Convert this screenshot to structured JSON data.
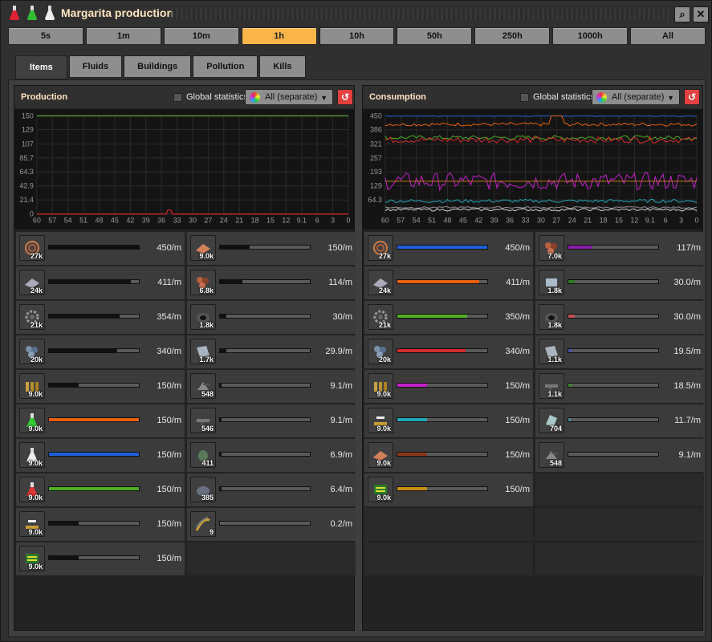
{
  "window": {
    "title": "Margarita production"
  },
  "title_icons": [
    "red-science-flask-icon",
    "green-science-flask-icon",
    "white-science-flask-icon"
  ],
  "time_buttons": [
    "5s",
    "1m",
    "10m",
    "1h",
    "10h",
    "50h",
    "250h",
    "1000h",
    "All"
  ],
  "active_time": "1h",
  "tabs": [
    "Items",
    "Fluids",
    "Buildings",
    "Pollution",
    "Kills"
  ],
  "active_tab": "Items",
  "production": {
    "title": "Production",
    "global_label": "Global statistics",
    "dropdown": "All (separate)",
    "chart_data": {
      "type": "line",
      "ylim": [
        0,
        150
      ],
      "yticks": [
        "150",
        "129",
        "107",
        "85.7",
        "64.3",
        "42.9",
        "21.4",
        "0"
      ],
      "xticks": [
        "60",
        "57",
        "54",
        "51",
        "48",
        "45",
        "42",
        "39",
        "36",
        "33",
        "30",
        "27",
        "24",
        "21",
        "18",
        "15",
        "12",
        "9.1",
        "6",
        "3",
        "0"
      ],
      "series": [
        {
          "color": "#6bb03a",
          "values": [
            150,
            150,
            150,
            150,
            150,
            150,
            150,
            150,
            150,
            150,
            150,
            150,
            150,
            150,
            150,
            150,
            150,
            150,
            150,
            150,
            150
          ]
        },
        {
          "color": "#d62b2b",
          "values": [
            0,
            0,
            0,
            0,
            0,
            0,
            0,
            0,
            0,
            0,
            0,
            0,
            0,
            0,
            0,
            0,
            0,
            0,
            0,
            0,
            0
          ],
          "spike_x": 34.5,
          "spike_y": 6
        }
      ]
    },
    "items": [
      {
        "icon": "copper-cable-icon",
        "count": "27k",
        "rate": "450/m",
        "fill": 1.0,
        "color": "#111111"
      },
      {
        "icon": "iron-plate-icon",
        "count": "24k",
        "rate": "411/m",
        "fill": 0.91,
        "color": "#111111"
      },
      {
        "icon": "iron-gear-wheel-icon",
        "count": "21k",
        "rate": "354/m",
        "fill": 0.79,
        "color": "#111111"
      },
      {
        "icon": "iron-ore-icon",
        "count": "20k",
        "rate": "340/m",
        "fill": 0.76,
        "color": "#111111"
      },
      {
        "icon": "firearm-magazine-icon",
        "count": "9.0k",
        "rate": "150/m",
        "fill": 0.33,
        "color": "#111111"
      },
      {
        "icon": "logistic-science-pack-icon",
        "count": "9.0k",
        "rate": "150/m",
        "fill": 1.0,
        "color": "#e8600c"
      },
      {
        "icon": "automation-science-pack-icon",
        "count": "9.0k",
        "rate": "150/m",
        "fill": 1.0,
        "color": "#1e5fd8"
      },
      {
        "icon": "military-science-pack-icon",
        "count": "9.0k",
        "rate": "150/m",
        "fill": 1.0,
        "color": "#4fae24"
      },
      {
        "icon": "inserter-icon",
        "count": "9.0k",
        "rate": "150/m",
        "fill": 0.33,
        "color": "#111111"
      },
      {
        "icon": "electronic-circuit-icon",
        "count": "9.0k",
        "rate": "150/m",
        "fill": 0.33,
        "color": "#111111"
      },
      {
        "icon": "copper-plate-icon",
        "count": "9.0k",
        "rate": "150/m",
        "fill": 0.33,
        "color": "#111111"
      },
      {
        "icon": "copper-ore-icon",
        "count": "6.8k",
        "rate": "114/m",
        "fill": 0.25,
        "color": "#111111"
      },
      {
        "icon": "stone-furnace-icon",
        "count": "1.8k",
        "rate": "30/m",
        "fill": 0.07,
        "color": "#111111"
      },
      {
        "icon": "steel-plate-icon",
        "count": "1.7k",
        "rate": "29.9/m",
        "fill": 0.07,
        "color": "#111111"
      },
      {
        "icon": "gun-turret-icon",
        "count": "548",
        "rate": "9.1/m",
        "fill": 0.02,
        "color": "#111111"
      },
      {
        "icon": "submachine-gun-icon",
        "count": "546",
        "rate": "9.1/m",
        "fill": 0.02,
        "color": "#111111"
      },
      {
        "icon": "grenade-icon",
        "count": "411",
        "rate": "6.9/m",
        "fill": 0.015,
        "color": "#111111"
      },
      {
        "icon": "stone-icon",
        "count": "385",
        "rate": "6.4/m",
        "fill": 0.015,
        "color": "#111111"
      },
      {
        "icon": "rail-icon",
        "count": "9",
        "rate": "0.2/m",
        "fill": 0.0,
        "color": "#111111"
      }
    ]
  },
  "consumption": {
    "title": "Consumption",
    "global_label": "Global statistics",
    "dropdown": "All (separate)",
    "chart_data": {
      "type": "line",
      "ylim": [
        0,
        450
      ],
      "yticks": [
        "450",
        "386",
        "321",
        "257",
        "193",
        "129",
        "64.3"
      ],
      "xticks": [
        "60",
        "57",
        "54",
        "51",
        "48",
        "45",
        "42",
        "39",
        "36",
        "33",
        "30",
        "27",
        "24",
        "21",
        "18",
        "15",
        "12",
        "9.1",
        "6",
        "3",
        "0"
      ],
      "series": [
        {
          "color": "#1e5fd8",
          "base": 450,
          "jitter": 4
        },
        {
          "color": "#e8600c",
          "base": 411,
          "jitter": 8
        },
        {
          "color": "#4fae24",
          "base": 350,
          "jitter": 10
        },
        {
          "color": "#d62b2b",
          "base": 340,
          "jitter": 14
        },
        {
          "color": "#c320c8",
          "base": 150,
          "jitter": 40
        },
        {
          "color": "#1fa8b8",
          "base": 60,
          "jitter": 8
        },
        {
          "color": "#c07a1a",
          "base": 150,
          "jitter": 0
        },
        {
          "color": "#8e8e8e",
          "base": 30,
          "jitter": 4
        },
        {
          "color": "#d0d0d0",
          "base": 20,
          "jitter": 6
        }
      ]
    },
    "items": [
      {
        "icon": "copper-cable-icon",
        "count": "27k",
        "rate": "450/m",
        "fill": 1.0,
        "color": "#1e5fd8"
      },
      {
        "icon": "iron-plate-icon",
        "count": "24k",
        "rate": "411/m",
        "fill": 0.91,
        "color": "#e8600c"
      },
      {
        "icon": "iron-gear-wheel-icon",
        "count": "21k",
        "rate": "350/m",
        "fill": 0.78,
        "color": "#4fae24"
      },
      {
        "icon": "iron-ore-icon",
        "count": "20k",
        "rate": "340/m",
        "fill": 0.76,
        "color": "#d62b2b"
      },
      {
        "icon": "firearm-magazine-icon",
        "count": "9.0k",
        "rate": "150/m",
        "fill": 0.33,
        "color": "#c320c8"
      },
      {
        "icon": "inserter-icon",
        "count": "9.0k",
        "rate": "150/m",
        "fill": 0.33,
        "color": "#1fa8b8"
      },
      {
        "icon": "copper-plate-icon",
        "count": "9.0k",
        "rate": "150/m",
        "fill": 0.33,
        "color": "#8a3a1a"
      },
      {
        "icon": "electronic-circuit-icon",
        "count": "9.0k",
        "rate": "150/m",
        "fill": 0.33,
        "color": "#c9900f"
      },
      {
        "icon": "copper-ore-icon",
        "count": "7.0k",
        "rate": "117/m",
        "fill": 0.26,
        "color": "#8a1aa8"
      },
      {
        "icon": "stone-brick-icon",
        "count": "1.8k",
        "rate": "30.0/m",
        "fill": 0.07,
        "color": "#2e7a22"
      },
      {
        "icon": "stone-furnace-icon",
        "count": "1.8k",
        "rate": "30.0/m",
        "fill": 0.07,
        "color": "#c05050"
      },
      {
        "icon": "steel-plate-icon",
        "count": "1.1k",
        "rate": "19.5/m",
        "fill": 0.04,
        "color": "#5050b0"
      },
      {
        "icon": "submachine-gun-icon",
        "count": "1.1k",
        "rate": "18.5/m",
        "fill": 0.04,
        "color": "#3a8a2a"
      },
      {
        "icon": "piercing-rounds-icon",
        "count": "704",
        "rate": "11.7/m",
        "fill": 0.026,
        "color": "#4a8a8a"
      },
      {
        "icon": "gun-turret-icon",
        "count": "548",
        "rate": "9.1/m",
        "fill": 0.02,
        "color": "#555555"
      }
    ]
  }
}
